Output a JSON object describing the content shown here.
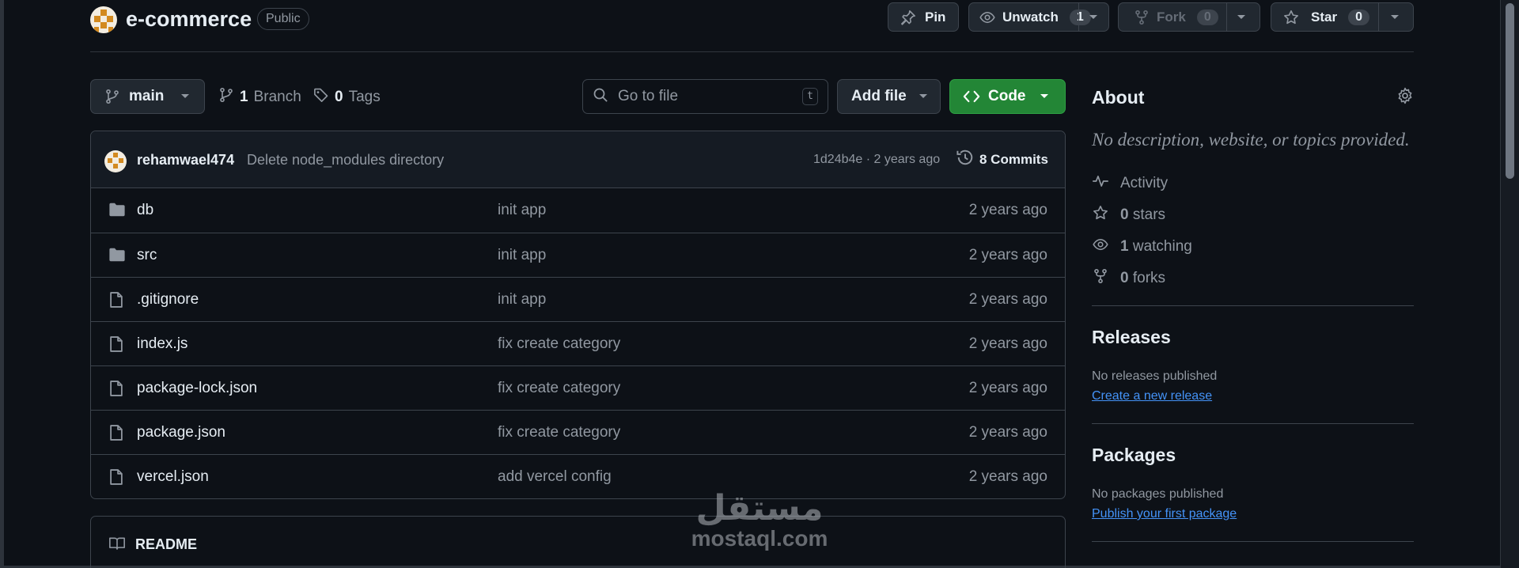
{
  "repo": {
    "name": "e-commerce",
    "visibility": "Public"
  },
  "actions": {
    "pin_label": "Pin",
    "unwatch_label": "Unwatch",
    "unwatch_count": "1",
    "fork_label": "Fork",
    "fork_count": "0",
    "star_label": "Star",
    "star_count": "0"
  },
  "toolbar": {
    "branch": "main",
    "branches_count": "1",
    "branches_label": "Branch",
    "tags_count": "0",
    "tags_label": "Tags",
    "search_placeholder": "Go to file",
    "search_shortcut": "t",
    "add_file_label": "Add file",
    "code_label": "Code"
  },
  "latest_commit": {
    "author": "rehamwael474",
    "message": "Delete node_modules directory",
    "hash_time": "1d24b4e · 2 years ago",
    "commits_label": "8 Commits"
  },
  "files": [
    {
      "type": "folder",
      "name": "db",
      "message": "init app",
      "date": "2 years ago"
    },
    {
      "type": "folder",
      "name": "src",
      "message": "init app",
      "date": "2 years ago"
    },
    {
      "type": "file",
      "name": ".gitignore",
      "message": "init app",
      "date": "2 years ago"
    },
    {
      "type": "file",
      "name": "index.js",
      "message": "fix create category",
      "date": "2 years ago"
    },
    {
      "type": "file",
      "name": "package-lock.json",
      "message": "fix create category",
      "date": "2 years ago"
    },
    {
      "type": "file",
      "name": "package.json",
      "message": "fix create category",
      "date": "2 years ago"
    },
    {
      "type": "file",
      "name": "vercel.json",
      "message": "add vercel config",
      "date": "2 years ago"
    }
  ],
  "readme": {
    "label": "README"
  },
  "about": {
    "title": "About",
    "description": "No description, website, or topics provided.",
    "activity_label": "Activity",
    "stars_count": "0",
    "stars_label": "stars",
    "watching_count": "1",
    "watching_label": "watching",
    "forks_count": "0",
    "forks_label": "forks"
  },
  "releases": {
    "title": "Releases",
    "empty_text": "No releases published",
    "create_link": "Create a new release"
  },
  "packages": {
    "title": "Packages",
    "empty_text": "No packages published",
    "publish_link": "Publish your first package"
  },
  "watermark": {
    "arabic": "مستقل",
    "latin": "mostaql.com"
  },
  "colors": {
    "background": "#0d1117",
    "border": "#3d444d",
    "code_button": "#238636",
    "link": "#4493f8",
    "muted_text": "#9198a1"
  }
}
